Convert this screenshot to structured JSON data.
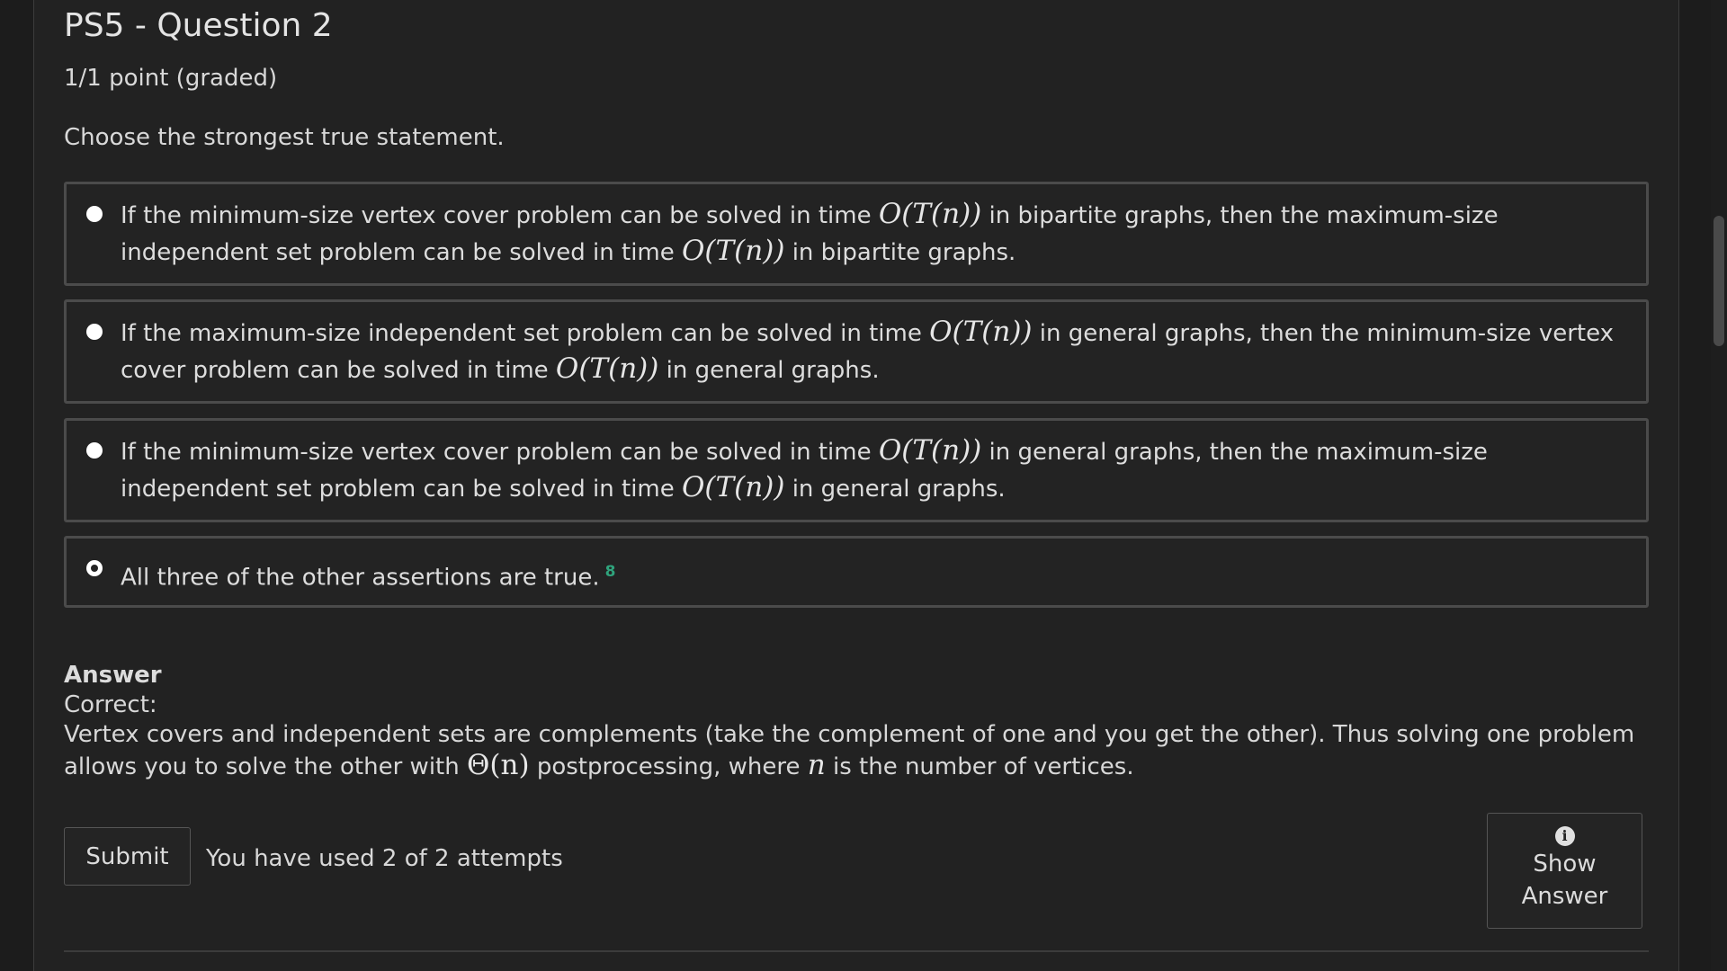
{
  "problem": {
    "title": "PS5 - Question 2",
    "points": "1/1 point (graded)",
    "prompt": "Choose the strongest true statement."
  },
  "math": {
    "big_o": "O(T(n))",
    "theta": "Θ(n)",
    "n": "n"
  },
  "options": [
    {
      "p1": "If the minimum-size vertex cover problem can be solved in time ",
      "p2": " in bipartite graphs, then the maximum-size independent set problem can be solved in time ",
      "p3": " in bipartite graphs.",
      "selected": false
    },
    {
      "p1": "If the maximum-size independent set problem can be solved in time ",
      "p2": " in general graphs, then the minimum-size vertex cover problem can be solved in time ",
      "p3": " in general graphs.",
      "selected": false
    },
    {
      "p1": "If the minimum-size vertex cover problem can be solved in time ",
      "p2": " in general graphs, then the maximum-size independent set problem can be solved in time ",
      "p3": " in general graphs.",
      "selected": false
    },
    {
      "text": "All three of the other assertions are true.",
      "mark": "8",
      "selected": true
    }
  ],
  "answer": {
    "heading": "Answer",
    "status": "Correct:",
    "t1": "Vertex covers and independent sets are complements (take the complement of one and you get the other). Thus solving one problem allows you to solve the other with ",
    "t2": " postprocessing, where ",
    "t3": " is the number of vertices."
  },
  "actions": {
    "submit_label": "Submit",
    "attempts": "You have used 2 of 2 attempts",
    "show_answer_line1": "Show",
    "show_answer_line2": "Answer",
    "info_glyph": "i"
  },
  "colors": {
    "background": "#222222",
    "border": "#4b4b4b",
    "correct": "#2fa37c"
  }
}
